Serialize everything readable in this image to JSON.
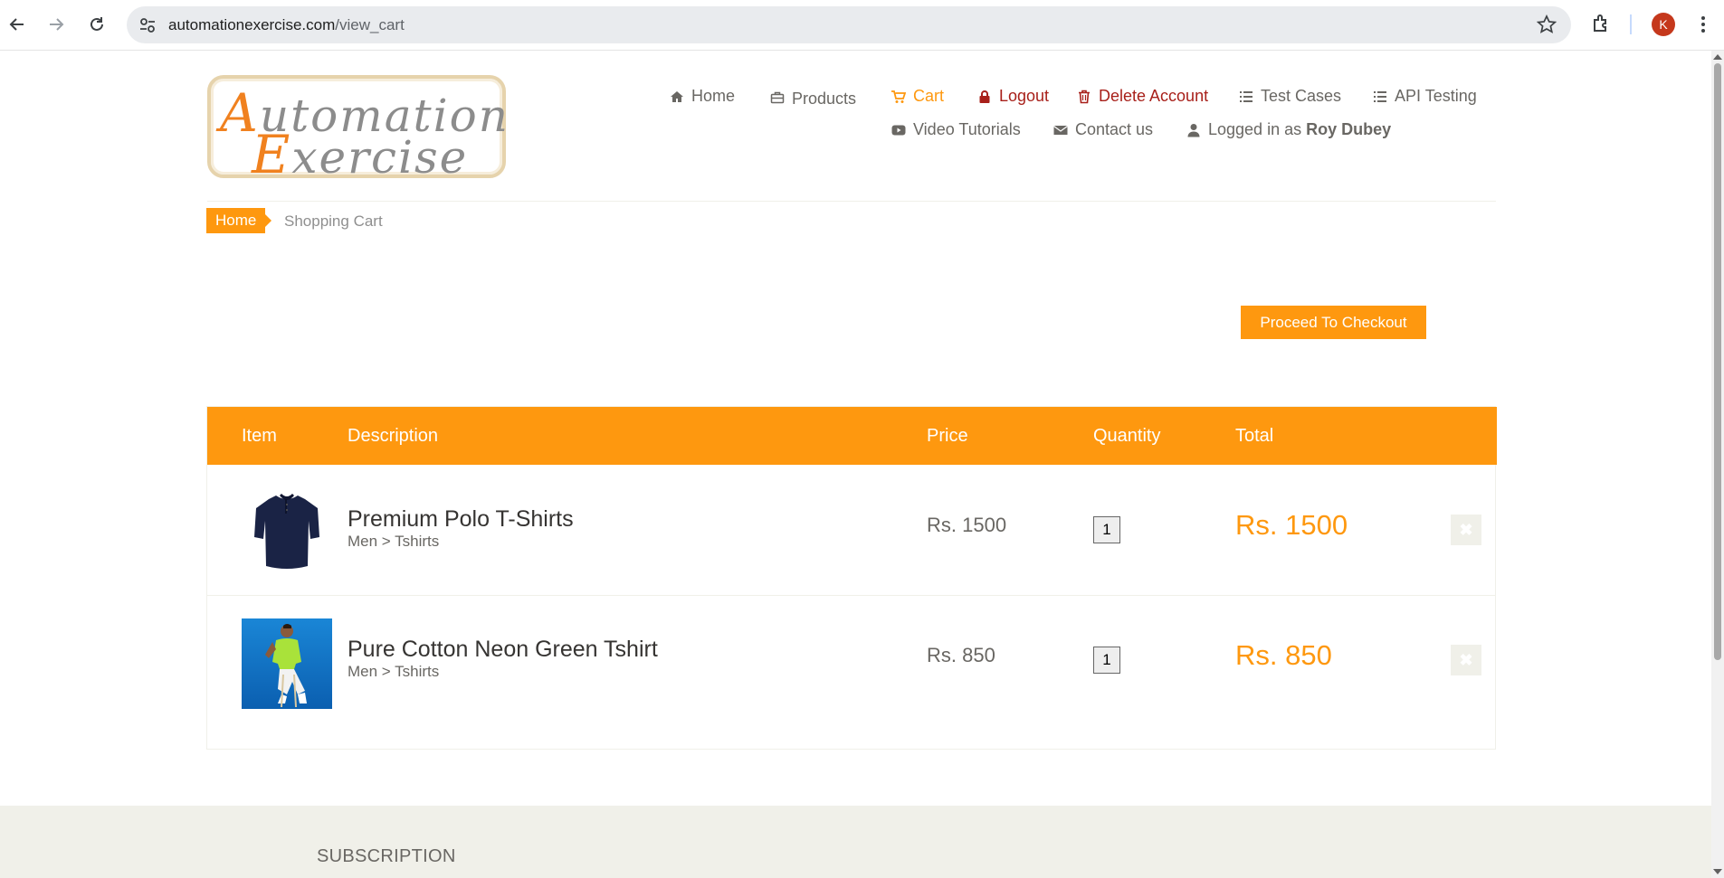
{
  "browser": {
    "url_domain": "automationexercise.com",
    "url_path": "/view_cart",
    "profile_initial": "K"
  },
  "logo": {
    "line1_cap": "A",
    "line1_rest": "utomation",
    "line2_cap": "E",
    "line2_rest": "xercise"
  },
  "nav": {
    "home": "Home",
    "products": "Products",
    "cart": "Cart",
    "logout": "Logout",
    "delete_account": "Delete Account",
    "test_cases": "Test Cases",
    "api_testing": "API Testing",
    "video_tutorials": "Video Tutorials",
    "contact_us": "Contact us",
    "logged_in_prefix": "Logged in as",
    "logged_in_user": "Roy Dubey"
  },
  "breadcrumb": {
    "home": "Home",
    "current": "Shopping Cart"
  },
  "checkout_label": "Proceed To Checkout",
  "table": {
    "headers": [
      "Item",
      "Description",
      "Price",
      "Quantity",
      "Total"
    ],
    "rows": [
      {
        "name": "Premium Polo T-Shirts",
        "category": "Men > Tshirts",
        "price": "Rs. 1500",
        "quantity": "1",
        "total": "Rs. 1500"
      },
      {
        "name": "Pure Cotton Neon Green Tshirt",
        "category": "Men > Tshirts",
        "price": "Rs. 850",
        "quantity": "1",
        "total": "Rs. 850"
      }
    ]
  },
  "footer": {
    "subscription": "SUBSCRIPTION"
  },
  "colors": {
    "accent": "#fe980f",
    "danger": "#a8201a",
    "footer_bg": "#f0f0e9"
  }
}
